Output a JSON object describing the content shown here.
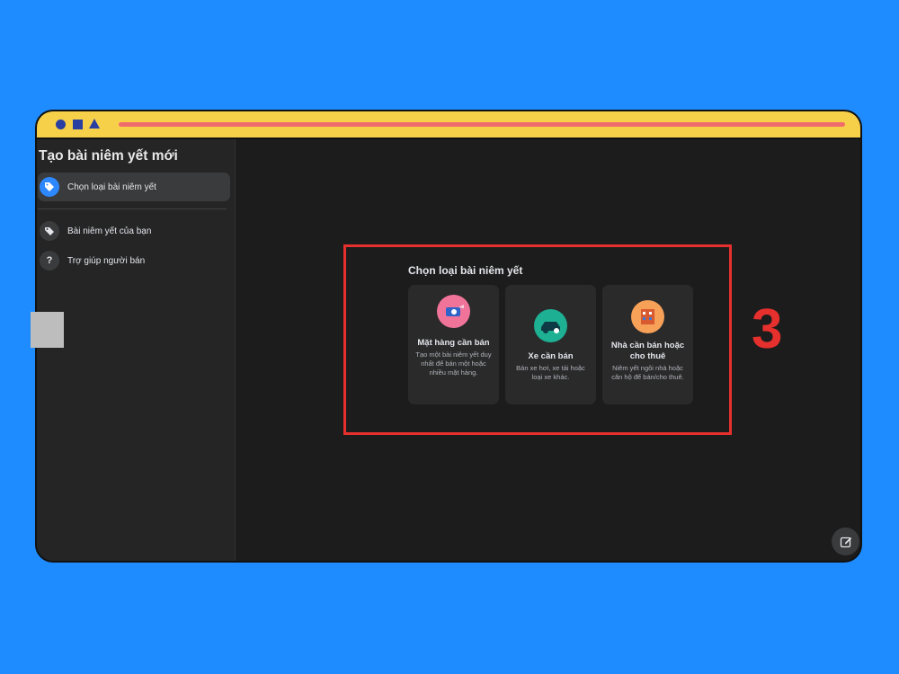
{
  "sidebar": {
    "title": "Tạo bài niêm yết mới",
    "items": [
      {
        "label": "Chọn loại bài niêm yết",
        "icon": "tag-icon"
      },
      {
        "label": "Bài niêm yết của bạn",
        "icon": "tags-icon"
      },
      {
        "label": "Trợ giúp người bán",
        "icon": "help-icon"
      }
    ]
  },
  "main": {
    "title": "Chọn loại bài niêm yết",
    "cards": [
      {
        "title": "Mặt hàng cần bán",
        "desc": "Tạo một bài niêm yết duy nhất để bán một hoặc nhiều mặt hàng.",
        "icon": "item-icon"
      },
      {
        "title": "Xe cần bán",
        "desc": "Bán xe hơi, xe tải hoặc loại xe khác.",
        "icon": "car-icon"
      },
      {
        "title": "Nhà cần bán hoặc cho thuê",
        "desc": "Niêm yết ngôi nhà hoặc căn hộ để bán/cho thuê.",
        "icon": "house-icon"
      }
    ]
  },
  "annotation": {
    "step": "3"
  },
  "colors": {
    "background": "#1e8cff",
    "titlebar": "#f7d04a",
    "highlight": "#e5302d",
    "accent": "#2d88ff"
  }
}
